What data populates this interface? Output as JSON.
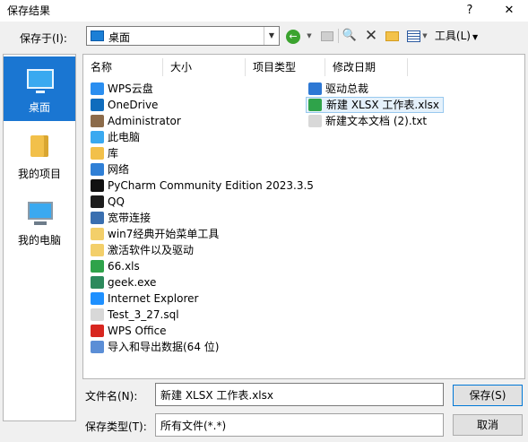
{
  "window": {
    "title": "保存结果",
    "help": "?",
    "close": "✕"
  },
  "toolbar": {
    "save_in_label": "保存于(I):",
    "location": "桌面",
    "tools_label": "工具(L)",
    "dropdown_arrow": "▼"
  },
  "places": [
    {
      "label": "桌面",
      "icon": "desktop-icon",
      "selected": true
    },
    {
      "label": "我的项目",
      "icon": "folder-icon"
    },
    {
      "label": "我的电脑",
      "icon": "computer-icon"
    }
  ],
  "columns": [
    "名称",
    "大小",
    "项目类型",
    "修改日期"
  ],
  "files_left": [
    {
      "name": "WPS云盘",
      "icon": "cloud-icon",
      "color": "#2a8ef0"
    },
    {
      "name": "OneDrive",
      "icon": "onedrive-icon",
      "color": "#0f6cbd"
    },
    {
      "name": "Administrator",
      "icon": "user-icon",
      "color": "#8c6b4a"
    },
    {
      "name": "此电脑",
      "icon": "computer-icon",
      "color": "#3aa9f0"
    },
    {
      "name": "库",
      "icon": "library-icon",
      "color": "#f2c04a"
    },
    {
      "name": "网络",
      "icon": "network-icon",
      "color": "#2f7fd6"
    },
    {
      "name": "PyCharm Community Edition 2023.3.5",
      "icon": "pycharm-icon",
      "color": "#111111"
    },
    {
      "name": "QQ",
      "icon": "qq-icon",
      "color": "#1d1d1d"
    },
    {
      "name": "宽带连接",
      "icon": "broadband-icon",
      "color": "#3a6fb0"
    },
    {
      "name": "win7经典开始菜单工具",
      "icon": "folder-icon",
      "color": "#f3cf6a"
    },
    {
      "name": "激活软件以及驱动",
      "icon": "folder-icon",
      "color": "#f3cf6a"
    },
    {
      "name": "66.xls",
      "icon": "spreadsheet-icon",
      "color": "#2fa34a"
    },
    {
      "name": "geek.exe",
      "icon": "exe-icon",
      "color": "#2c8a5c"
    },
    {
      "name": "Internet Explorer",
      "icon": "ie-icon",
      "color": "#1e90ff"
    },
    {
      "name": "Test_3_27.sql",
      "icon": "text-file-icon",
      "color": "#d8d8d8"
    },
    {
      "name": "WPS Office",
      "icon": "wps-icon",
      "color": "#d8261f"
    },
    {
      "name": "导入和导出数据(64 位)",
      "icon": "import-export-icon",
      "color": "#5b8ed6"
    }
  ],
  "files_right": [
    {
      "name": "驱动总裁",
      "icon": "driver-icon",
      "color": "#2d78d4"
    },
    {
      "name": "新建 XLSX 工作表.xlsx",
      "icon": "spreadsheet-icon",
      "color": "#2fa34a",
      "selected": true
    },
    {
      "name": "新建文本文档 (2).txt",
      "icon": "text-file-icon",
      "color": "#d8d8d8"
    }
  ],
  "filename": {
    "label": "文件名(N):",
    "value": "新建 XLSX 工作表.xlsx"
  },
  "filetype": {
    "label": "保存类型(T):",
    "value": "所有文件(*.*)"
  },
  "buttons": {
    "save": "保存(S)",
    "cancel": "取消"
  }
}
